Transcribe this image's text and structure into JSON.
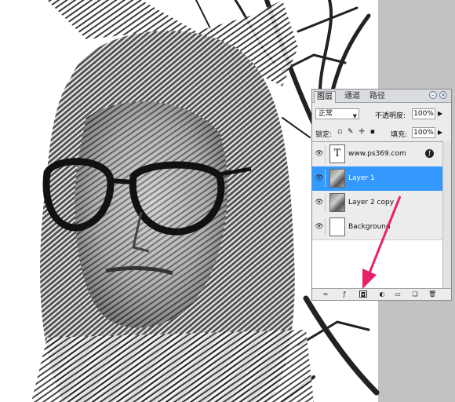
{
  "panel": {
    "tabs": [
      "图层",
      "通道",
      "路径"
    ],
    "active_tab": "图层",
    "blend_mode": "正常",
    "opacity_label": "不透明度:",
    "opacity_value": "100%",
    "lock_label": "锁定:",
    "fill_label": "填充:",
    "fill_value": "100%",
    "layers": [
      {
        "name": "www.ps369.com",
        "kind": "text-layer",
        "thumb_glyph": "T",
        "visible": true,
        "selected": false,
        "has_fx": true
      },
      {
        "name": "Layer 1",
        "kind": "photo-layer",
        "visible": true,
        "selected": true,
        "has_fx": false
      },
      {
        "name": "Layer 2 copy",
        "kind": "photo-layer",
        "visible": true,
        "selected": false,
        "has_fx": false
      },
      {
        "name": "Background",
        "kind": "background-layer",
        "visible": true,
        "selected": false,
        "has_fx": false
      }
    ],
    "bottom_icons": [
      "link-layers-icon",
      "layer-style-icon",
      "add-mask-icon",
      "adjustment-layer-icon",
      "new-group-icon",
      "new-layer-icon",
      "delete-layer-icon"
    ]
  },
  "colors": {
    "selection": "#3399ff",
    "arrow": "#e8206a",
    "canvas_grey": "#c2c2c2"
  }
}
